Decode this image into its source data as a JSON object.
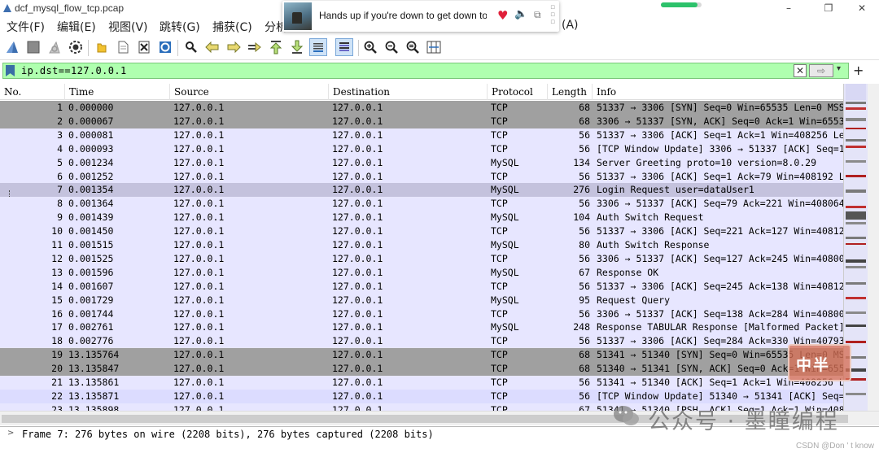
{
  "window": {
    "title": "dcf_mysql_flow_tcp.pcap",
    "minimize": "–",
    "maximize": "❐",
    "close": "✕",
    "progress_fraction": 0.9
  },
  "menu": [
    {
      "label": "文件(F)"
    },
    {
      "label": "编辑(E)"
    },
    {
      "label": "视图(V)"
    },
    {
      "label": "跳转(G)"
    },
    {
      "label": "捕获(C)"
    },
    {
      "label": "分析"
    },
    {
      "label": "(A)"
    }
  ],
  "notification": {
    "song": "Hands up if you're down to get down tonight",
    "heart": "♥",
    "volume": "🔈",
    "more": "⧉"
  },
  "toolbar": [
    {
      "icon": "shark-fin-start-icon"
    },
    {
      "icon": "stop-square-icon"
    },
    {
      "icon": "restart-fin-icon"
    },
    {
      "icon": "capture-options-gear-icon"
    },
    {
      "icon": "open-folder-icon"
    },
    {
      "icon": "save-file-icon"
    },
    {
      "icon": "close-file-icon"
    },
    {
      "icon": "reload-icon"
    },
    {
      "icon": "find-packet-icon"
    },
    {
      "icon": "go-back-icon"
    },
    {
      "icon": "go-forward-icon"
    },
    {
      "icon": "go-to-packet-icon"
    },
    {
      "icon": "go-first-icon"
    },
    {
      "icon": "go-last-icon"
    },
    {
      "icon": "autoscroll-icon"
    },
    {
      "icon": "colorize-icon"
    },
    {
      "icon": "zoom-in-icon"
    },
    {
      "icon": "zoom-out-icon"
    },
    {
      "icon": "zoom-normal-icon"
    },
    {
      "icon": "resize-columns-icon"
    }
  ],
  "filter": {
    "expression": "ip.dst==127.0.0.1",
    "clear": "✕",
    "apply": "⇨",
    "dropdown": "▾",
    "add": "+"
  },
  "columns": [
    "No.",
    "Time",
    "Source",
    "Destination",
    "Protocol",
    "Length",
    "Info"
  ],
  "colors": {
    "row_tcp": "#e7e6ff",
    "row_syn": "#a0a0a0",
    "row_selected": "#c4c2dd",
    "row_window": "#dcdcff"
  },
  "packets": [
    {
      "no": "1",
      "time": "0.000000",
      "src": "127.0.0.1",
      "dst": "127.0.0.1",
      "proto": "TCP",
      "len": "68",
      "info": "51337 → 3306 [SYN] Seq=0 Win=65535 Len=0 MSS=",
      "style": "syn"
    },
    {
      "no": "2",
      "time": "0.000067",
      "src": "127.0.0.1",
      "dst": "127.0.0.1",
      "proto": "TCP",
      "len": "68",
      "info": "3306 → 51337 [SYN, ACK] Seq=0 Ack=1 Win=65535",
      "style": "syn"
    },
    {
      "no": "3",
      "time": "0.000081",
      "src": "127.0.0.1",
      "dst": "127.0.0.1",
      "proto": "TCP",
      "len": "56",
      "info": "51337 → 3306 [ACK] Seq=1 Ack=1 Win=408256 Len",
      "style": "tcp"
    },
    {
      "no": "4",
      "time": "0.000093",
      "src": "127.0.0.1",
      "dst": "127.0.0.1",
      "proto": "TCP",
      "len": "56",
      "info": "[TCP Window Update] 3306 → 51337 [ACK] Seq=1",
      "style": "tcp"
    },
    {
      "no": "5",
      "time": "0.001234",
      "src": "127.0.0.1",
      "dst": "127.0.0.1",
      "proto": "MySQL",
      "len": "134",
      "info": "Server Greeting  proto=10 version=8.0.29",
      "style": "tcp"
    },
    {
      "no": "6",
      "time": "0.001252",
      "src": "127.0.0.1",
      "dst": "127.0.0.1",
      "proto": "TCP",
      "len": "56",
      "info": "51337 → 3306 [ACK] Seq=1 Ack=79 Win=408192 Le",
      "style": "tcp"
    },
    {
      "no": "7",
      "time": "0.001354",
      "src": "127.0.0.1",
      "dst": "127.0.0.1",
      "proto": "MySQL",
      "len": "276",
      "info": "Login Request user=dataUser1",
      "style": "selected"
    },
    {
      "no": "8",
      "time": "0.001364",
      "src": "127.0.0.1",
      "dst": "127.0.0.1",
      "proto": "TCP",
      "len": "56",
      "info": "3306 → 51337 [ACK] Seq=79 Ack=221 Win=408064",
      "style": "tcp"
    },
    {
      "no": "9",
      "time": "0.001439",
      "src": "127.0.0.1",
      "dst": "127.0.0.1",
      "proto": "MySQL",
      "len": "104",
      "info": "Auth Switch Request",
      "style": "tcp"
    },
    {
      "no": "10",
      "time": "0.001450",
      "src": "127.0.0.1",
      "dst": "127.0.0.1",
      "proto": "TCP",
      "len": "56",
      "info": "51337 → 3306 [ACK] Seq=221 Ack=127 Win=408128",
      "style": "tcp"
    },
    {
      "no": "11",
      "time": "0.001515",
      "src": "127.0.0.1",
      "dst": "127.0.0.1",
      "proto": "MySQL",
      "len": "80",
      "info": "Auth Switch Response",
      "style": "tcp"
    },
    {
      "no": "12",
      "time": "0.001525",
      "src": "127.0.0.1",
      "dst": "127.0.0.1",
      "proto": "TCP",
      "len": "56",
      "info": "3306 → 51337 [ACK] Seq=127 Ack=245 Win=408000",
      "style": "tcp"
    },
    {
      "no": "13",
      "time": "0.001596",
      "src": "127.0.0.1",
      "dst": "127.0.0.1",
      "proto": "MySQL",
      "len": "67",
      "info": "Response  OK",
      "style": "tcp"
    },
    {
      "no": "14",
      "time": "0.001607",
      "src": "127.0.0.1",
      "dst": "127.0.0.1",
      "proto": "TCP",
      "len": "56",
      "info": "51337 → 3306 [ACK] Seq=245 Ack=138 Win=408128",
      "style": "tcp"
    },
    {
      "no": "15",
      "time": "0.001729",
      "src": "127.0.0.1",
      "dst": "127.0.0.1",
      "proto": "MySQL",
      "len": "95",
      "info": "Request Query",
      "style": "tcp"
    },
    {
      "no": "16",
      "time": "0.001744",
      "src": "127.0.0.1",
      "dst": "127.0.0.1",
      "proto": "TCP",
      "len": "56",
      "info": "3306 → 51337 [ACK] Seq=138 Ack=284 Win=408000",
      "style": "tcp"
    },
    {
      "no": "17",
      "time": "0.002761",
      "src": "127.0.0.1",
      "dst": "127.0.0.1",
      "proto": "MySQL",
      "len": "248",
      "info": "Response TABULAR Response [Malformed Packet]",
      "style": "tcp"
    },
    {
      "no": "18",
      "time": "0.002776",
      "src": "127.0.0.1",
      "dst": "127.0.0.1",
      "proto": "TCP",
      "len": "56",
      "info": "51337 → 3306 [ACK] Seq=284 Ack=330 Win=407936",
      "style": "tcp"
    },
    {
      "no": "19",
      "time": "13.135764",
      "src": "127.0.0.1",
      "dst": "127.0.0.1",
      "proto": "TCP",
      "len": "68",
      "info": "51341 → 51340 [SYN] Seq=0 Win=65535 Len=0 MSS",
      "style": "syn"
    },
    {
      "no": "20",
      "time": "13.135847",
      "src": "127.0.0.1",
      "dst": "127.0.0.1",
      "proto": "TCP",
      "len": "68",
      "info": "51340 → 51341 [SYN, ACK] Seq=0 Ack=1 Win=6553",
      "style": "syn"
    },
    {
      "no": "21",
      "time": "13.135861",
      "src": "127.0.0.1",
      "dst": "127.0.0.1",
      "proto": "TCP",
      "len": "56",
      "info": "51341 → 51340 [ACK] Seq=1 Ack=1 Win=408256 Le",
      "style": "tcp"
    },
    {
      "no": "22",
      "time": "13.135871",
      "src": "127.0.0.1",
      "dst": "127.0.0.1",
      "proto": "TCP",
      "len": "56",
      "info": "[TCP Window Update] 51340 → 51341 [ACK] Seq=1",
      "style": "window"
    },
    {
      "no": "23",
      "time": "13.135898",
      "src": "127.0.0.1",
      "dst": "127.0.0.1",
      "proto": "TCP",
      "len": "67",
      "info": "51341 → 51340 [PSH, ACK] Seq=1 Ack=1 Win=4082",
      "style": "tcp"
    }
  ],
  "details": {
    "arrow": ">",
    "frame_summary": "Frame 7: 276 bytes on wire (2208 bits), 276 bytes captured (2208 bits)"
  },
  "watermark": {
    "stamp": "中半",
    "text": "公众号 · 墨瞳编程",
    "csdn": "CSDN @Don ' t know"
  }
}
